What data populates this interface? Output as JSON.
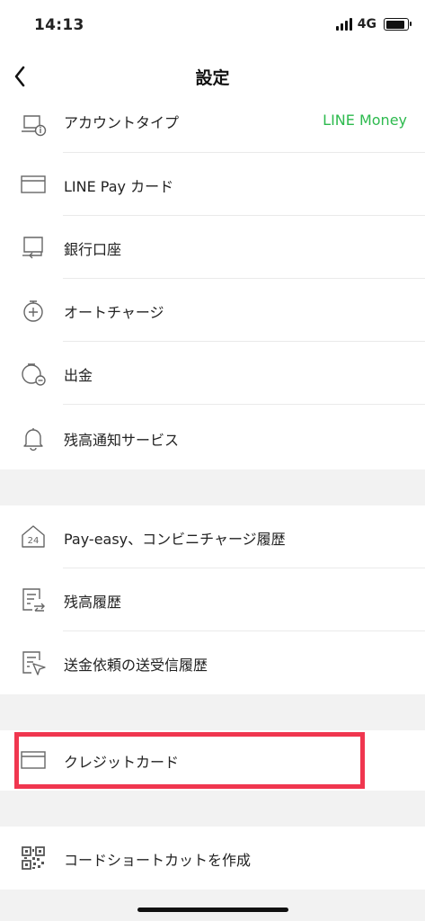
{
  "status": {
    "time": "14:13",
    "network": "4G"
  },
  "header": {
    "title": "設定"
  },
  "sections": [
    {
      "items": [
        {
          "label": "アカウントタイプ",
          "value": "LINE Money",
          "icon": "account-info-icon"
        },
        {
          "label": "LINE Pay カード",
          "icon": "card-icon"
        },
        {
          "label": "銀行口座",
          "icon": "bank-account-icon"
        },
        {
          "label": "オートチャージ",
          "icon": "auto-charge-icon"
        },
        {
          "label": "出金",
          "icon": "withdraw-icon"
        },
        {
          "label": "残高通知サービス",
          "icon": "bell-icon"
        }
      ]
    },
    {
      "items": [
        {
          "label": "Pay-easy、コンビニチャージ履歴",
          "icon": "store-24-icon"
        },
        {
          "label": "残高履歴",
          "icon": "history-icon"
        },
        {
          "label": "送金依頼の送受信履歴",
          "icon": "transfer-history-icon"
        }
      ]
    },
    {
      "items": [
        {
          "label": "クレジットカード",
          "icon": "credit-card-icon"
        }
      ]
    },
    {
      "items": [
        {
          "label": "コードショートカットを作成",
          "icon": "qr-code-icon"
        }
      ]
    }
  ],
  "colors": {
    "accent_green": "#2dba4e",
    "highlight_red": "#f0364f",
    "section_gap": "#f2f2f2"
  }
}
